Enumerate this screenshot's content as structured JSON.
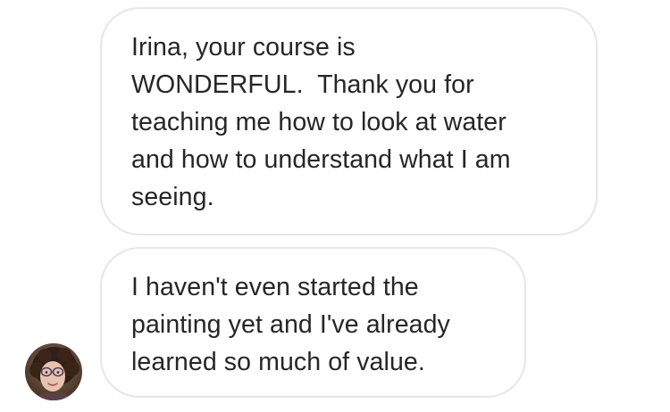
{
  "conversation": {
    "messages": [
      {
        "sender": "user",
        "lines": [
          "Irina, your course is",
          "WONDERFUL.  Thank you for",
          "teaching me how to look at water",
          "and how to understand what I am",
          "seeing."
        ]
      },
      {
        "sender": "user",
        "lines": [
          "I haven't even started the",
          "painting yet and I've already",
          "learned so much of value."
        ]
      }
    ]
  },
  "colors": {
    "bubble_border": "#e6e6e6",
    "text": "#262626",
    "background": "#ffffff"
  },
  "icons": {
    "avatar": "user-avatar-photo"
  }
}
